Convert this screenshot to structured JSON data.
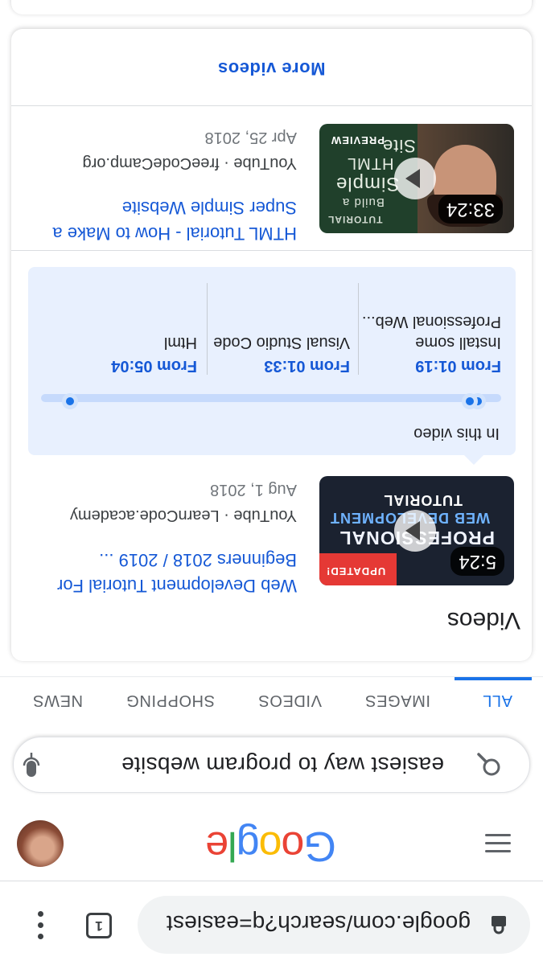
{
  "browser": {
    "url": "google.com/search?q=easiest",
    "tab_count": "1"
  },
  "google": {
    "logo_letters": [
      "G",
      "o",
      "o",
      "g",
      "l",
      "e"
    ],
    "logo_colors": [
      "#4285f4",
      "#ea4335",
      "#fbbc05",
      "#4285f4",
      "#34a853",
      "#ea4335"
    ]
  },
  "search": {
    "query": "easiest way to program website"
  },
  "tabs": [
    "ALL",
    "IMAGES",
    "VIDEOS",
    "SHOPPING",
    "NEWS"
  ],
  "videos": {
    "heading": "Videos",
    "more_label": "More videos",
    "items": [
      {
        "title": "Web Development Tutorial For Beginners 2018 / 2019 ...",
        "source": "YouTube · LearnCode.academy",
        "date": "Aug 1, 2018",
        "duration": "5:24",
        "thumb_lines": [
          "UPDATED!",
          "PROFESSIONAL",
          "WEB DEVELOPMENT",
          "TUTORIAL"
        ]
      },
      {
        "title": "HTML Tutorial - How to Make a Super Simple Website",
        "source": "YouTube · freeCodeCamp.org",
        "date": "Apr 25, 2018",
        "duration": "33:24",
        "thumb_lines": [
          "TUTORIAL",
          "Build a",
          "Simple",
          "HTML",
          "Site",
          "PREVIEW"
        ]
      }
    ],
    "in_this_video": {
      "label": "In this video",
      "chapters": [
        {
          "time": "From 01:19",
          "title": "Install some Professional Web..."
        },
        {
          "time": "From 01:33",
          "title": "Visual Studio Code"
        },
        {
          "time": "From 05:04",
          "title": "Html"
        }
      ],
      "chapter_fractions": [
        0.05,
        0.069,
        0.937
      ]
    }
  },
  "colors": {
    "link": "#1558d6",
    "accent": "#1a73e8",
    "chapter_bg": "#e8f0fe"
  }
}
